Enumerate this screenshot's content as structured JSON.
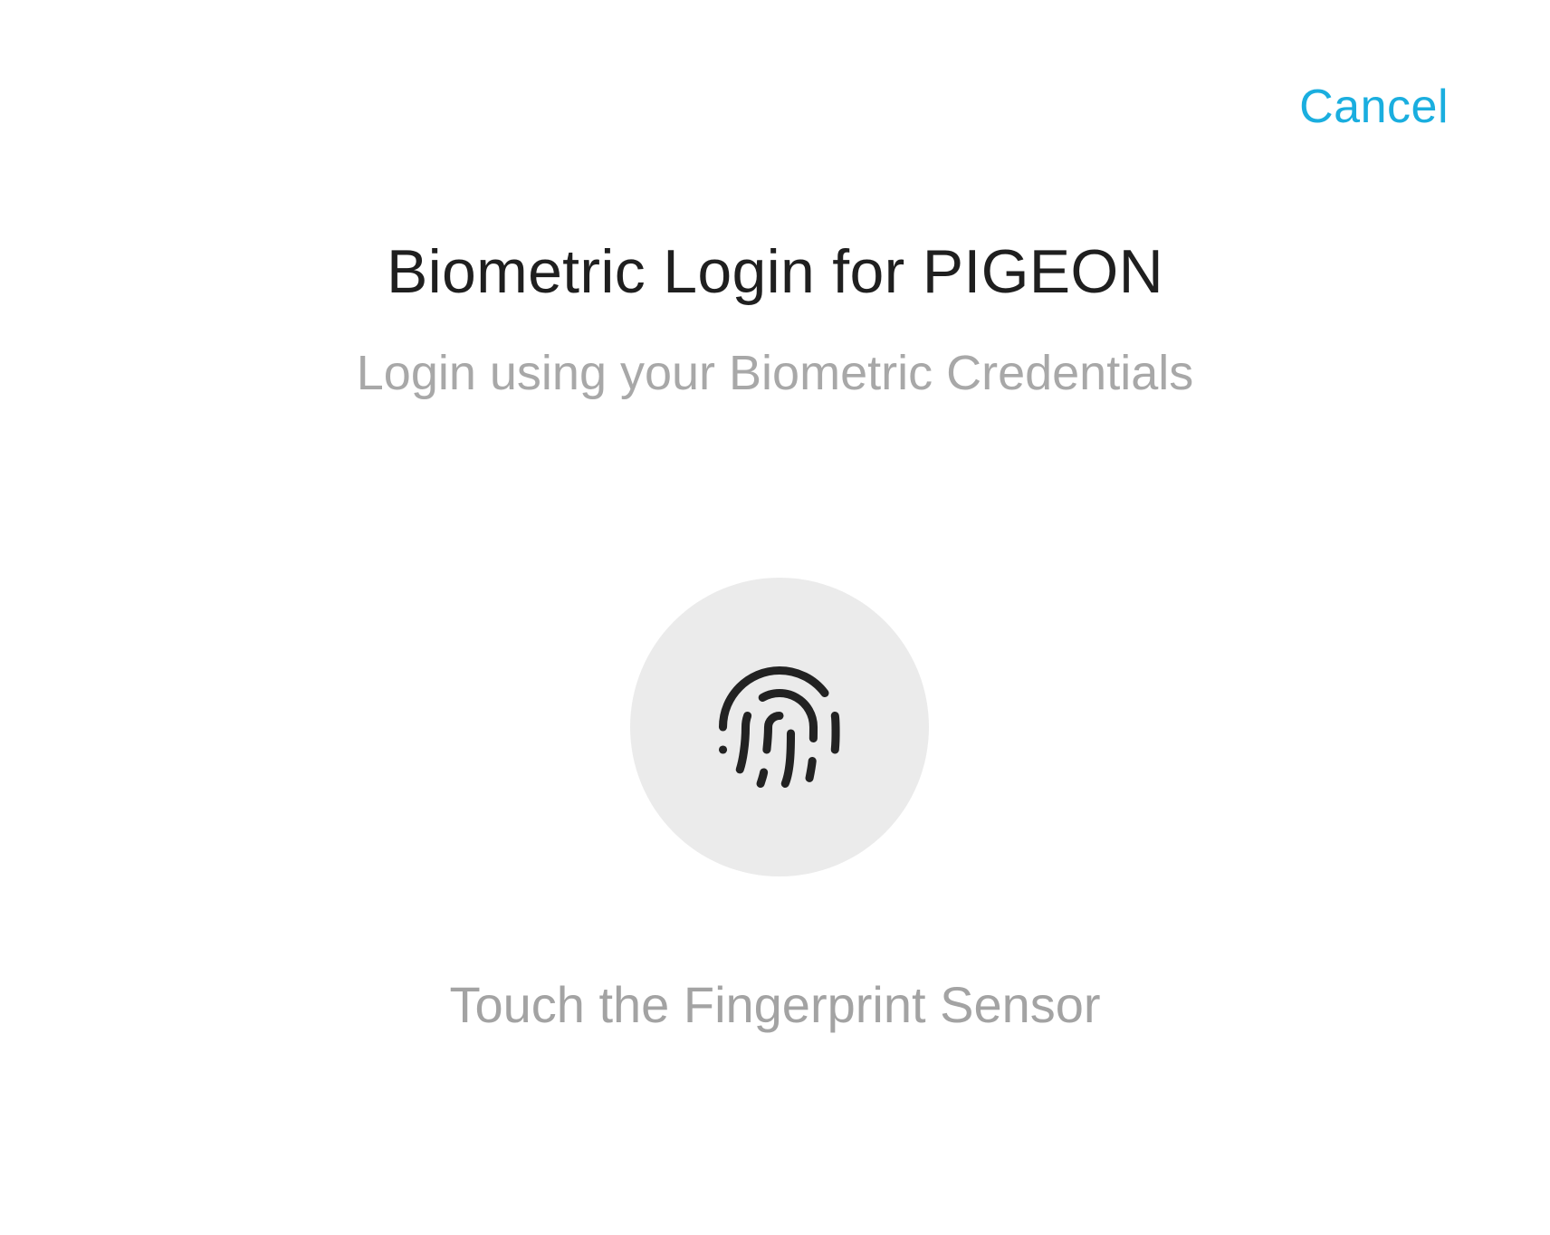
{
  "header": {
    "cancel_label": "Cancel"
  },
  "main": {
    "title": "Biometric Login for PIGEON",
    "subtitle": "Login using your Biometric Credentials",
    "fingerprint": {
      "icon": "fingerprint-icon"
    },
    "instruction": "Touch the Fingerprint Sensor"
  },
  "colors": {
    "accent": "#1aaedf",
    "title_text": "#1f1f1f",
    "muted_text": "#a8a8a8",
    "circle_bg": "#ebebeb",
    "icon": "#222222"
  }
}
